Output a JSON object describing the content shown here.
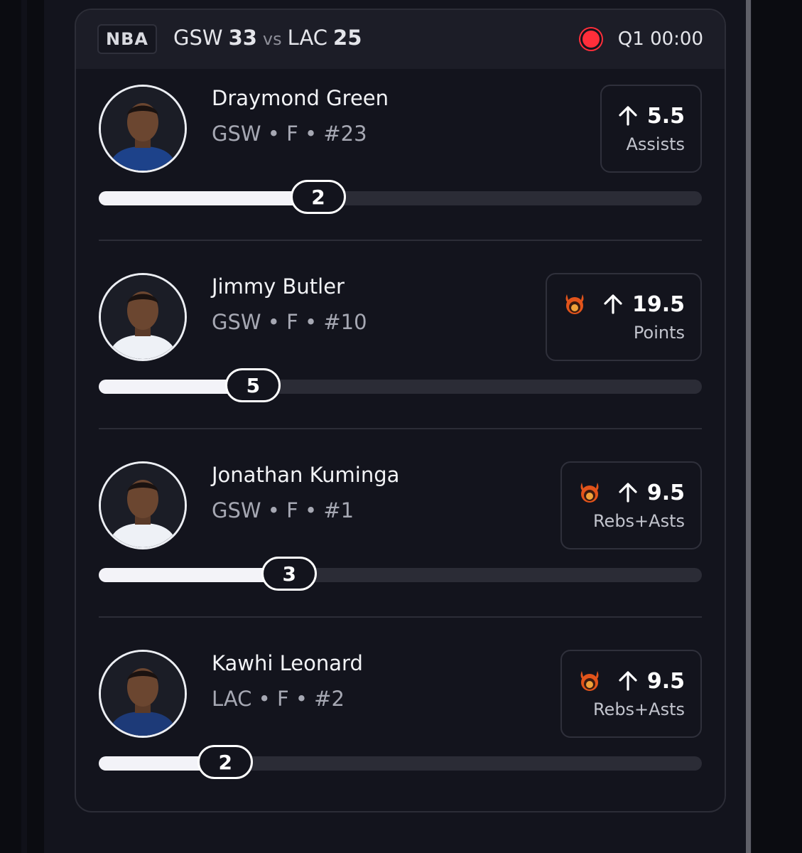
{
  "header": {
    "league": "NBA",
    "home_team": "GSW",
    "home_score": "33",
    "vs": "vs",
    "away_team": "LAC",
    "away_score": "25",
    "status": "Q1 00:00"
  },
  "players": [
    {
      "name": "Draymond Green",
      "meta": "GSW • F • #23",
      "line": "5.5",
      "stat": "Assists",
      "direction": "up",
      "demon": false,
      "current": "2",
      "progress": 0.364,
      "jersey_color": "#1d428a"
    },
    {
      "name": "Jimmy Butler",
      "meta": "GSW • F • #10",
      "line": "19.5",
      "stat": "Points",
      "direction": "up",
      "demon": true,
      "current": "5",
      "progress": 0.256,
      "jersey_color": "#eef1f6"
    },
    {
      "name": "Jonathan Kuminga",
      "meta": "GSW • F • #1",
      "line": "9.5",
      "stat": "Rebs+Asts",
      "direction": "up",
      "demon": true,
      "current": "3",
      "progress": 0.316,
      "jersey_color": "#eef1f6"
    },
    {
      "name": "Kawhi Leonard",
      "meta": "LAC • F • #2",
      "line": "9.5",
      "stat": "Rebs+Asts",
      "direction": "up",
      "demon": true,
      "current": "2",
      "progress": 0.21,
      "jersey_color": "#1d3a78"
    }
  ],
  "colors": {
    "live": "#ff2e3a",
    "demon": "#e2541b",
    "bar_fill": "#f3f3f8",
    "bar_track": "#2b2c36"
  }
}
